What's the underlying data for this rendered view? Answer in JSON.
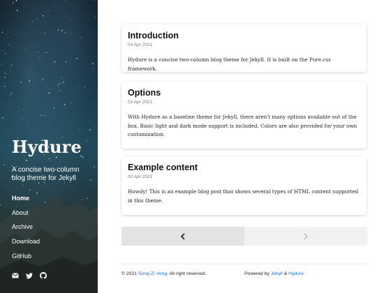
{
  "sidebar": {
    "brand": "Hydure",
    "tagline": "A concise two-column blog theme for Jekyll",
    "nav": [
      {
        "label": "Home",
        "active": true
      },
      {
        "label": "About",
        "active": false
      },
      {
        "label": "Archive",
        "active": false
      },
      {
        "label": "Download",
        "active": false
      },
      {
        "label": "GitHub",
        "active": false
      }
    ],
    "socials": [
      "email-icon",
      "twitter-icon",
      "github-icon"
    ]
  },
  "posts": [
    {
      "title": "Introduction",
      "date": "04 Apr 2021",
      "excerpt": "Hydure is a concise two-column blog theme for Jekyll. It is built on the Pure.css framework."
    },
    {
      "title": "Options",
      "date": "03 Apr 2021",
      "excerpt": "With Hydure as a baseline theme for Jekyll, there aren't many options available out of the box. Basic light and dark mode support is included. Colors are also provided for your own customization."
    },
    {
      "title": "Example content",
      "date": "02 Apr 2021",
      "excerpt": "Howdy! This is an example blog post that shows several types of HTML content supported in this theme."
    }
  ],
  "pagination": {
    "prev_icon": "chevron-left-icon",
    "next_icon": "chevron-right-icon",
    "prev_enabled": true,
    "next_enabled": false
  },
  "footer": {
    "copyright_prefix": "© 2021",
    "author": "Song-Zi Vong",
    "rights": ". All right reserved.",
    "powered_by": "Powered by",
    "jekyll": "Jekyll",
    "amp": "&",
    "hydure": "Hydure",
    "link_color": "#1a6ecf"
  }
}
